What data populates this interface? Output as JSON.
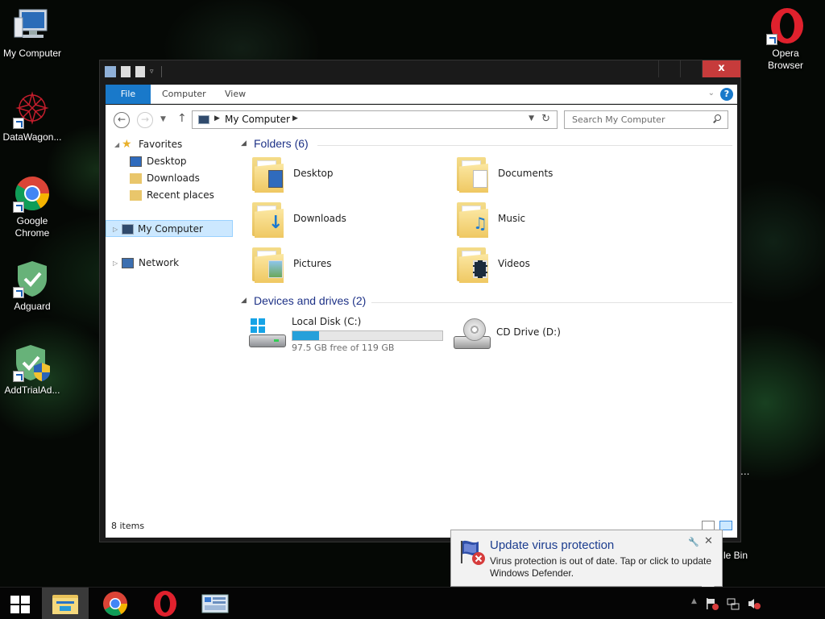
{
  "desktop": {
    "icons": [
      {
        "label": "My Computer"
      },
      {
        "label": "DataWagon..."
      },
      {
        "label": "Google Chrome"
      },
      {
        "label": "Adguard"
      },
      {
        "label": "AddTrialAd..."
      },
      {
        "label": "Opera Browser"
      }
    ],
    "recycle_label": "le Bin",
    "recycle_dots": "..."
  },
  "window": {
    "close_label": "x",
    "ribbon": {
      "tabs": [
        "File",
        "Computer",
        "View"
      ],
      "help": "?"
    },
    "address": {
      "location": "My Computer"
    },
    "search": {
      "placeholder": "Search My Computer"
    },
    "nav": {
      "favorites": "Favorites",
      "desktop": "Desktop",
      "downloads": "Downloads",
      "recent": "Recent places",
      "mycomputer": "My Computer",
      "network": "Network"
    },
    "groups": {
      "folders": "Folders (6)",
      "devices": "Devices and drives (2)"
    },
    "folders": [
      "Desktop",
      "Documents",
      "Downloads",
      "Music",
      "Pictures",
      "Videos"
    ],
    "drives": {
      "local": {
        "name": "Local Disk (C:)",
        "free_text": "97.5 GB free of 119 GB",
        "used_fraction": 0.18
      },
      "cd": {
        "name": "CD Drive (D:)"
      }
    },
    "status": {
      "items": "8 items"
    }
  },
  "notification": {
    "title": "Update virus protection",
    "body": "Virus protection is out of date. Tap or click to update Windows Defender.",
    "close": "✕"
  },
  "colors": {
    "accent": "#1979ca",
    "selection": "#cce8ff",
    "drive_bar": "#26a0da",
    "close_button": "#c63b3b"
  }
}
